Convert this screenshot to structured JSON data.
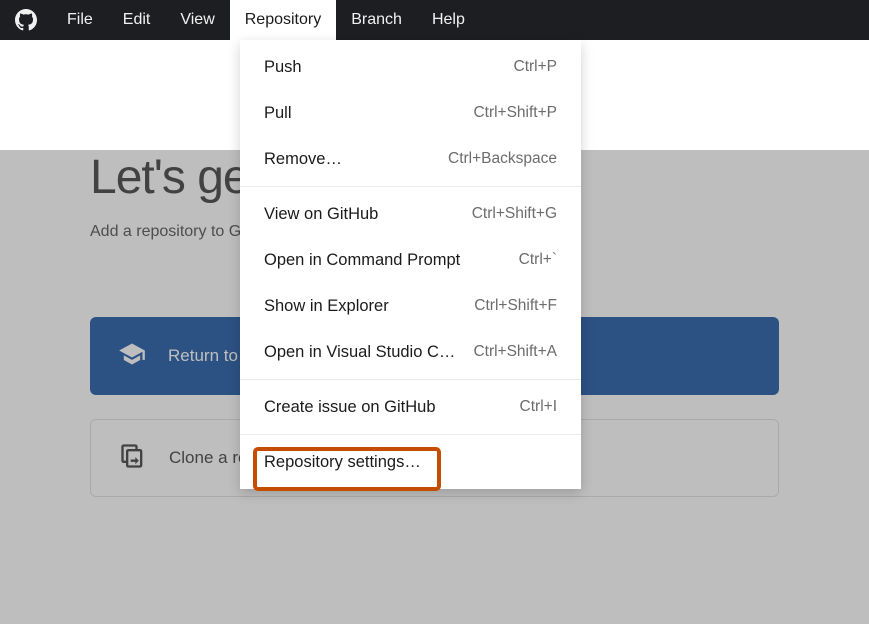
{
  "menu": {
    "items": [
      "File",
      "Edit",
      "View",
      "Repository",
      "Branch",
      "Help"
    ],
    "activeIndex": 3
  },
  "page": {
    "heading": "Let's get started!",
    "sub": "Add a repository to GitHub Desktop to start collaborating",
    "primaryBtn": "Return to GitHub Desktop",
    "secondaryBtn": "Clone a repository"
  },
  "dropdown": {
    "groups": [
      [
        {
          "label": "Push",
          "shortcut": "Ctrl+P"
        },
        {
          "label": "Pull",
          "shortcut": "Ctrl+Shift+P"
        },
        {
          "label": "Remove…",
          "shortcut": "Ctrl+Backspace"
        }
      ],
      [
        {
          "label": "View on GitHub",
          "shortcut": "Ctrl+Shift+G"
        },
        {
          "label": "Open in Command Prompt",
          "shortcut": "Ctrl+`"
        },
        {
          "label": "Show in Explorer",
          "shortcut": "Ctrl+Shift+F"
        },
        {
          "label": "Open in Visual Studio Code",
          "shortcut": "Ctrl+Shift+A"
        }
      ],
      [
        {
          "label": "Create issue on GitHub",
          "shortcut": "Ctrl+I"
        }
      ],
      [
        {
          "label": "Repository settings…",
          "shortcut": ""
        }
      ]
    ]
  }
}
